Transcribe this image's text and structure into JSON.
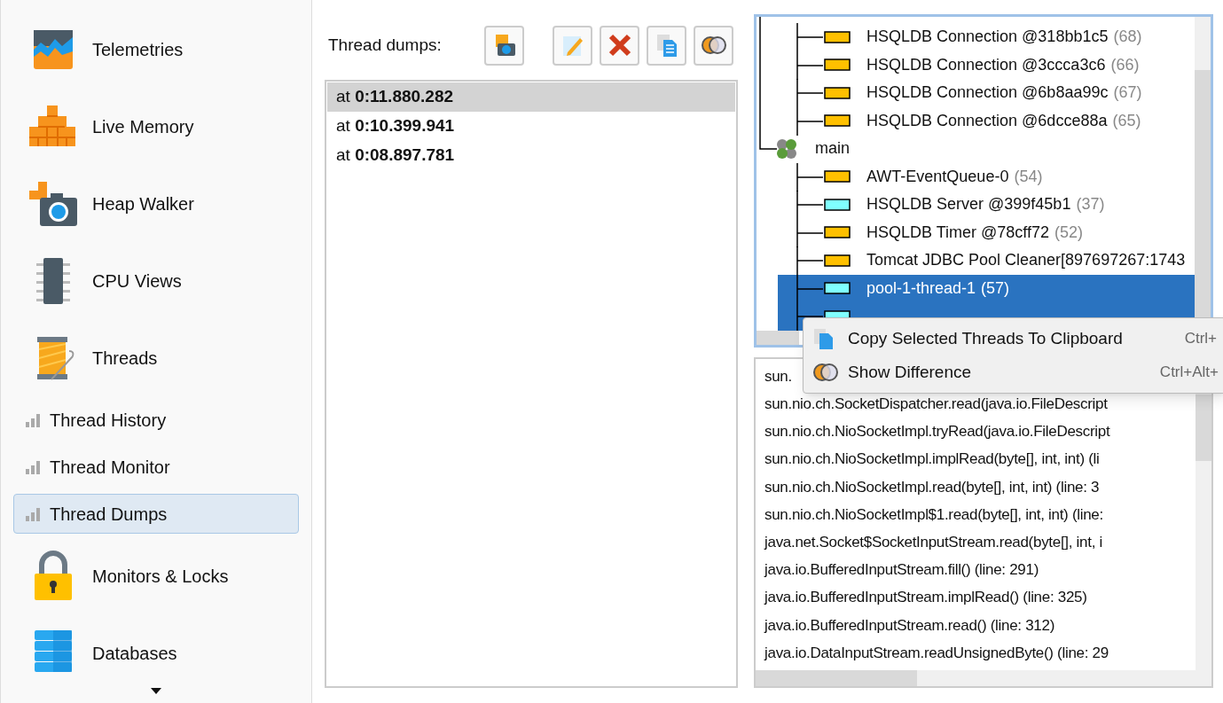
{
  "sidebar": {
    "items": [
      {
        "kind": "large",
        "label": "Telemetries",
        "selected": false
      },
      {
        "kind": "large",
        "label": "Live Memory",
        "selected": false
      },
      {
        "kind": "large",
        "label": "Heap Walker",
        "selected": false
      },
      {
        "kind": "large",
        "label": "CPU Views",
        "selected": false
      },
      {
        "kind": "large",
        "label": "Threads",
        "selected": false
      },
      {
        "kind": "sub",
        "label": "Thread History",
        "selected": false
      },
      {
        "kind": "sub",
        "label": "Thread Monitor",
        "selected": false
      },
      {
        "kind": "sub",
        "label": "Thread Dumps",
        "selected": true
      },
      {
        "kind": "large",
        "label": "Monitors & Locks",
        "selected": false
      },
      {
        "kind": "large",
        "label": "Databases",
        "selected": false
      }
    ]
  },
  "dumps": {
    "label": "Thread dumps:",
    "items": [
      {
        "text": "at **0:11.880.282**",
        "selected": true
      },
      {
        "text": "at **0:10.399.941**",
        "selected": false
      },
      {
        "text": "at **0:08.897.781**",
        "selected": false
      }
    ]
  },
  "tree": {
    "continued_nodes": [
      {
        "kind": "thread",
        "name": "HSQLDB Connection @318bb1c5",
        "id": "(68)",
        "color": "#ffc000",
        "selected": false
      },
      {
        "kind": "thread",
        "name": "HSQLDB Connection @3ccca3c6",
        "id": "(66)",
        "color": "#ffc000",
        "selected": false
      },
      {
        "kind": "thread",
        "name": "HSQLDB Connection @6b8aa99c",
        "id": "(67)",
        "color": "#ffc000",
        "selected": false
      },
      {
        "kind": "thread",
        "name": "HSQLDB Connection @6dcce88a",
        "id": "(65)",
        "color": "#ffc000",
        "selected": false
      }
    ],
    "nodes": [
      {
        "kind": "group",
        "name": "main",
        "children": [
          {
            "kind": "thread",
            "name": "AWT-EventQueue-0",
            "id": "(54)",
            "color": "#ffc000",
            "selected": false
          },
          {
            "kind": "thread",
            "name": "HSQLDB Server @399f45b1",
            "id": "(37)",
            "color": "#80ffff",
            "selected": false
          },
          {
            "kind": "thread",
            "name": "HSQLDB Timer @78cff72",
            "id": "(52)",
            "color": "#ffc000",
            "selected": false
          },
          {
            "kind": "thread",
            "name": "Tomcat JDBC Pool Cleaner[897697267:1743",
            "color": "#ffc000",
            "selected": false
          },
          {
            "kind": "thread",
            "name": "pool-1-thread-1",
            "id": "(57)",
            "color": "#80ffff",
            "selected": true
          },
          {
            "kind": "thread",
            "color": "#80ffff",
            "selected": true
          }
        ]
      }
    ]
  },
  "stack": [
    "sun.",
    "sun.nio.ch.SocketDispatcher.read(java.io.FileDescript",
    "sun.nio.ch.NioSocketImpl.tryRead(java.io.FileDescript",
    "sun.nio.ch.NioSocketImpl.implRead(byte[], int, int) (li",
    "sun.nio.ch.NioSocketImpl.read(byte[], int, int) (line: 3",
    "sun.nio.ch.NioSocketImpl$1.read(byte[], int, int) (line:",
    "java.net.Socket$SocketInputStream.read(byte[], int, i",
    "java.io.BufferedInputStream.fill() (line: 291)",
    "java.io.BufferedInputStream.implRead() (line: 325)",
    "java.io.BufferedInputStream.read() (line: 312)",
    "java.io.DataInputStream.readUnsignedByte() (line: 29"
  ],
  "context_menu": [
    {
      "label": "Copy Selected Threads To Clipboard",
      "shortcut": "Ctrl+"
    },
    {
      "label": "Show Difference",
      "shortcut": "Ctrl+Alt+"
    }
  ]
}
